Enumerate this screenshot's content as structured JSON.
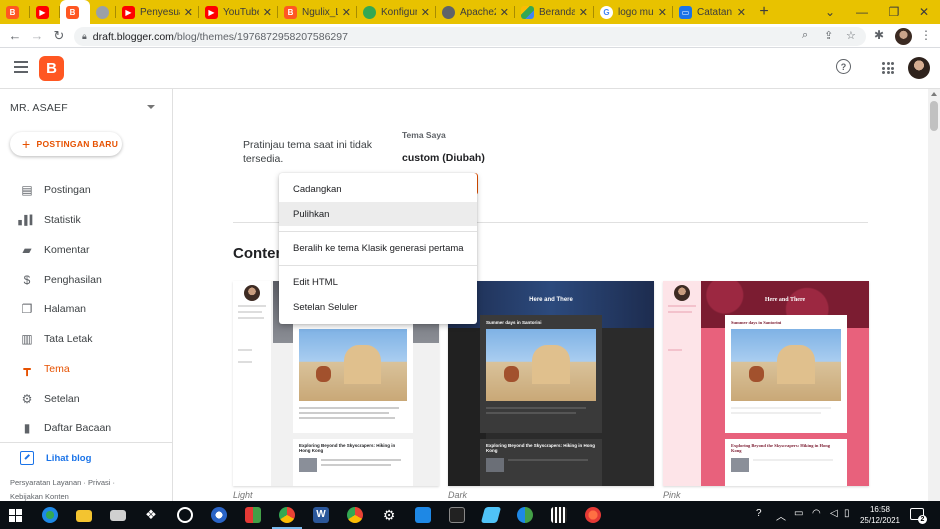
{
  "browser": {
    "tabs": [
      {
        "label": "",
        "icon": "blogger-icon",
        "color": "#ff5722",
        "active": false
      },
      {
        "label": "",
        "icon": "youtube-icon",
        "color": "#ff0000",
        "active": false
      },
      {
        "label": "",
        "icon": "blogger-icon",
        "color": "#ff5722",
        "active": true
      },
      {
        "label": "",
        "icon": "globe-icon",
        "color": "#5f6368",
        "active": false
      },
      {
        "label": "Penyesuai",
        "icon": "youtube-icon",
        "color": "#ff0000",
        "active": false
      },
      {
        "label": "YouTube",
        "icon": "youtube-icon",
        "color": "#ff0000",
        "active": false
      },
      {
        "label": "Ngulix_Lin",
        "icon": "blogger-icon",
        "color": "#ff5722",
        "active": false
      },
      {
        "label": "Konfigura",
        "icon": "wifi-icon",
        "color": "#34a853",
        "active": false
      },
      {
        "label": "Apache2",
        "icon": "globe-icon",
        "color": "#5f6368",
        "active": false
      },
      {
        "label": "Beranda",
        "icon": "drive-icon",
        "color": "#fbbc04",
        "active": false
      },
      {
        "label": "logo mus",
        "icon": "google-icon",
        "color": "#4285f4",
        "active": false
      },
      {
        "label": "Catatan M",
        "icon": "notes-icon",
        "color": "#1a73e8",
        "active": false
      }
    ],
    "url_host": "draft.blogger.com",
    "url_path": "/blog/themes/1976872958207586297"
  },
  "header": {
    "logo_letter": "B",
    "help_glyph": "?"
  },
  "sidebar": {
    "blog_name": "MR. ASAEF",
    "new_post_label": "POSTINGAN BARU",
    "items": [
      {
        "label": "Postingan",
        "icon": "posts-icon",
        "glyph": "▤",
        "active": false
      },
      {
        "label": "Statistik",
        "icon": "stats-icon",
        "glyph": "▮",
        "active": false
      },
      {
        "label": "Komentar",
        "icon": "comment-icon",
        "glyph": "▬",
        "active": false
      },
      {
        "label": "Penghasilan",
        "icon": "dollar-icon",
        "glyph": "$",
        "active": false
      },
      {
        "label": "Halaman",
        "icon": "pages-icon",
        "glyph": "❐",
        "active": false
      },
      {
        "label": "Tata Letak",
        "icon": "layout-icon",
        "glyph": "▥",
        "active": false
      },
      {
        "label": "Tema",
        "icon": "paint-roller-icon",
        "glyph": "┳",
        "active": true
      },
      {
        "label": "Setelan",
        "icon": "gear-icon",
        "glyph": "⚙",
        "active": false
      },
      {
        "label": "Daftar Bacaan",
        "icon": "bookmark-icon",
        "glyph": "▮",
        "active": false
      }
    ],
    "view_blog_label": "Lihat blog",
    "footer_line1": "Persyaratan Layanan · Privasi ·",
    "footer_line2": "Kebijakan Konten"
  },
  "main": {
    "preview_note": "Pratinjau tema saat ini tidak tersedia.",
    "my_theme_label": "Tema Saya",
    "my_theme_name": "custom (Diubah)",
    "section_title": "Contem",
    "themes": [
      {
        "label": "Light",
        "hero_title": ""
      },
      {
        "label": "Dark",
        "hero_title": "Here and There",
        "post_title": "Summer days in Santorini",
        "post2_title": "Exploring Beyond the Skyscrapers: Hiking in Hong Kong"
      },
      {
        "label": "Pink",
        "hero_title": "Here and There",
        "post_title": "Summer days in Santorini",
        "post2_title": "Exploring Beyond the Skyscrapers: Hiking in Hong Kong"
      }
    ],
    "light_post2_title": "Exploring Beyond the Skyscrapers: Hiking in Hong Kong"
  },
  "menu": {
    "items": [
      {
        "label": "Cadangkan",
        "hover": false
      },
      {
        "label": "Pulihkan",
        "hover": true
      },
      {
        "label": "Beralih ke tema Klasik generasi pertama",
        "hover": false
      },
      {
        "label": "Edit HTML",
        "hover": false
      },
      {
        "label": "Setelan Seluler",
        "hover": false
      }
    ]
  },
  "taskbar": {
    "time": "16:58",
    "date": "25/12/2021",
    "notification_count": "2"
  },
  "colors": {
    "accent": "#e65100",
    "blogger": "#ff5722",
    "chrome_tabstrip": "#e8c200",
    "link": "#1a73e8"
  }
}
